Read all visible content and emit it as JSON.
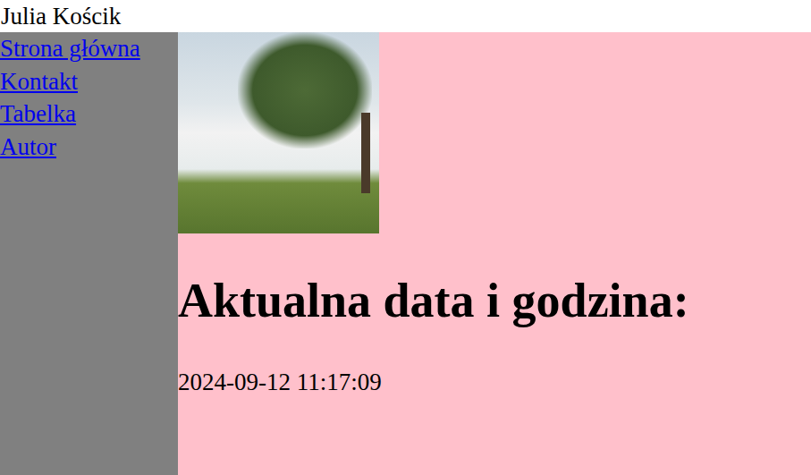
{
  "header": {
    "author": "Julia Kościk"
  },
  "sidebar": {
    "items": [
      {
        "label": "Strona główna"
      },
      {
        "label": "Kontakt"
      },
      {
        "label": "Tabelka"
      },
      {
        "label": "Autor"
      }
    ]
  },
  "main": {
    "heading": "Aktualna data i godzina:",
    "datetime": "2024-09-12 11:17:09"
  }
}
